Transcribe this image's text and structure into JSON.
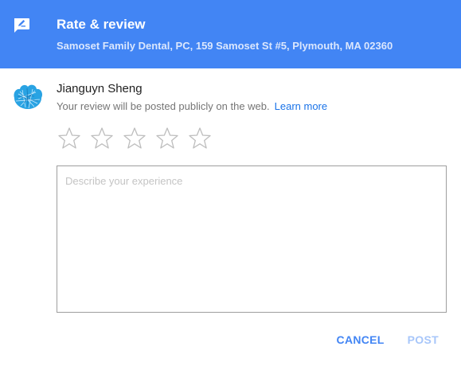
{
  "header": {
    "icon": "rate-review-icon",
    "title": "Rate & review",
    "subtitle": "Samoset Family Dental, PC, 159 Samoset St #5, Plymouth, MA 02360",
    "background_color": "#4285f4"
  },
  "user": {
    "avatar_icon": "avatar",
    "name": "Jianguyn Sheng",
    "notice": "Your review will be posted publicly on the web.",
    "learn_more_label": "Learn more"
  },
  "rating": {
    "max_stars": 5,
    "selected": 0,
    "star_icon": "star-outline-icon"
  },
  "review": {
    "value": "",
    "placeholder": "Describe your experience"
  },
  "actions": {
    "cancel_label": "CANCEL",
    "post_label": "POST",
    "accent_color": "#4285f4",
    "disabled_color": "#a7c6fa"
  }
}
